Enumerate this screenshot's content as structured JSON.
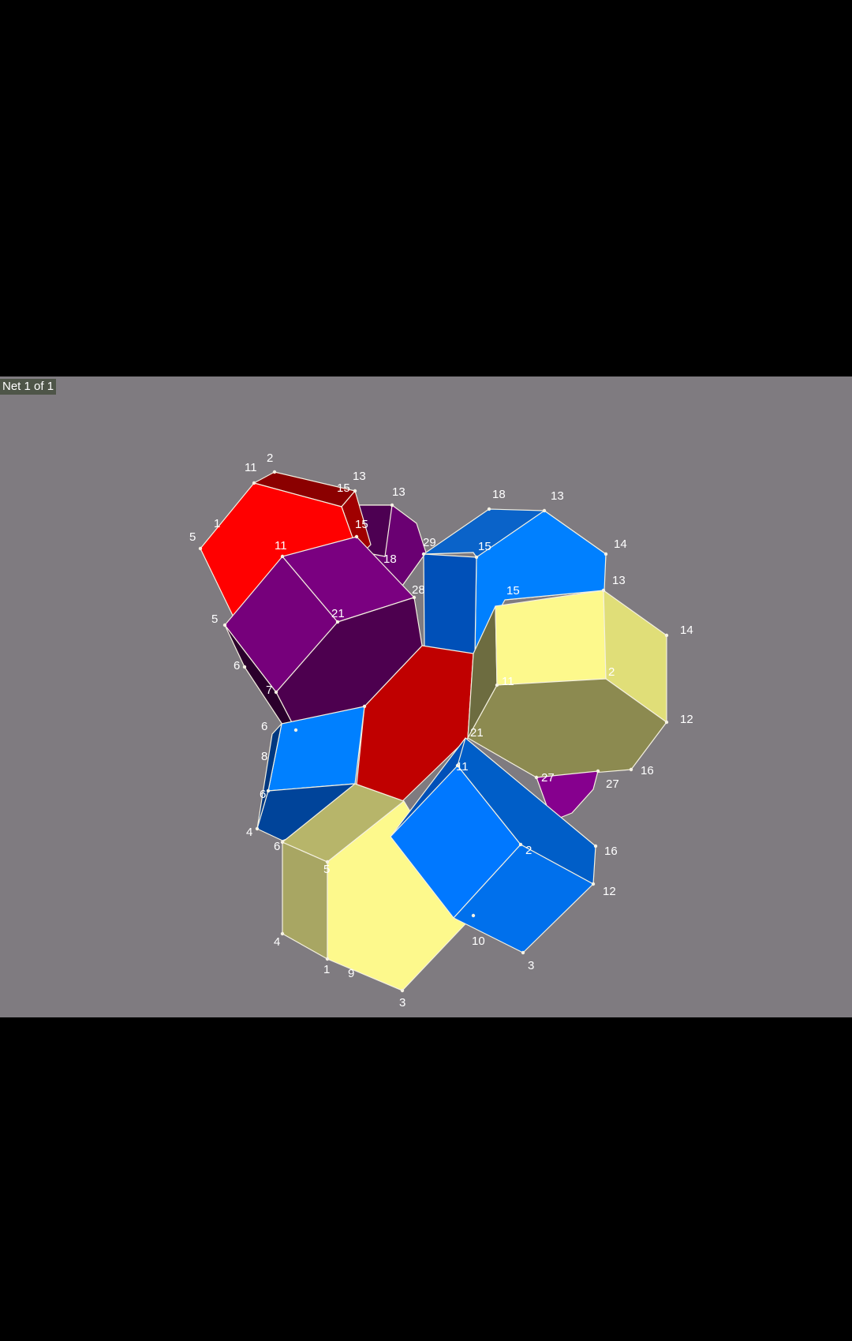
{
  "viewer": {
    "net_label": "Net 1 of 1",
    "background": "#7f7b80"
  },
  "colors": {
    "red": "#ff0000",
    "purple": "#76007b",
    "blue": "#0078ff",
    "yellow": "#fdf98c"
  },
  "vertex_labels": [
    "11",
    "2",
    "13",
    "15",
    "13",
    "5",
    "1",
    "11",
    "15",
    "18",
    "29",
    "15",
    "18",
    "13",
    "14",
    "13",
    "15",
    "28",
    "21",
    "14",
    "5",
    "6",
    "6",
    "7",
    "2",
    "11",
    "12",
    "8",
    "21",
    "11",
    "27",
    "16",
    "27",
    "6",
    "4",
    "6",
    "5",
    "2",
    "16",
    "12",
    "4",
    "1",
    "9",
    "10",
    "3",
    "3"
  ]
}
